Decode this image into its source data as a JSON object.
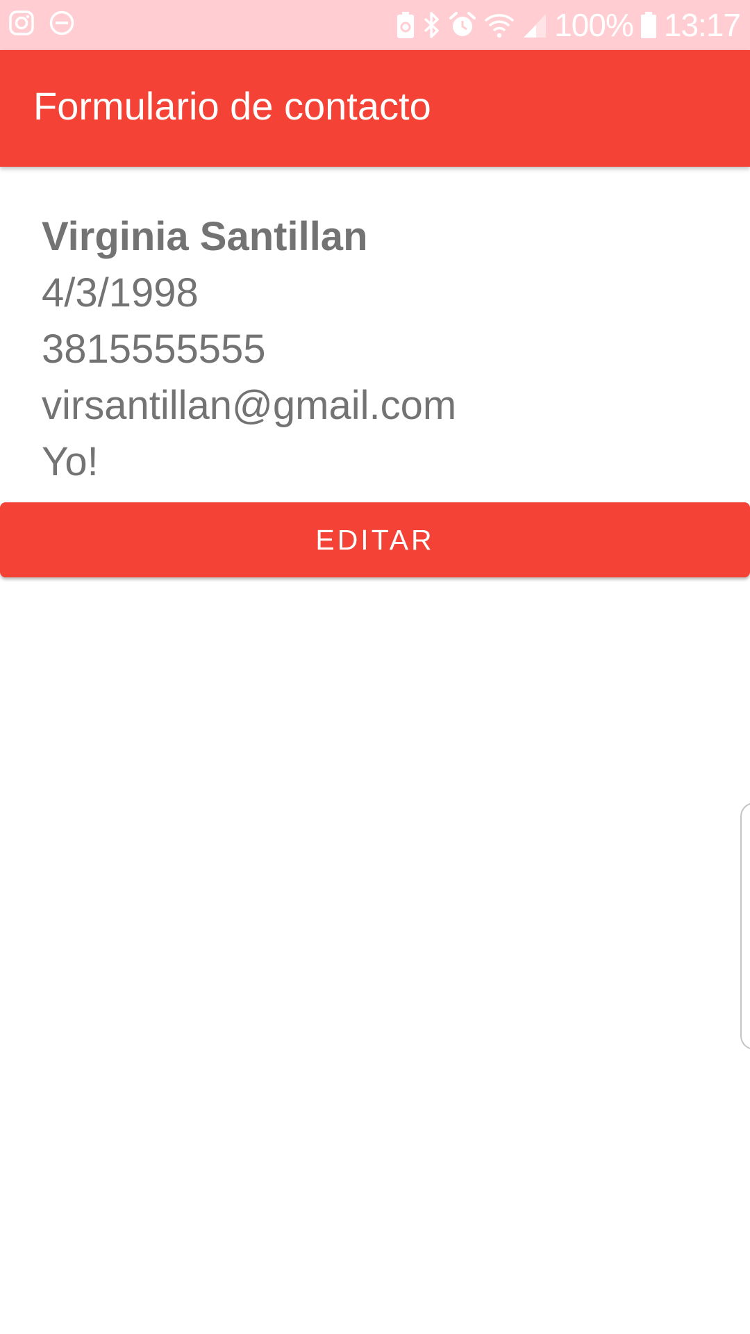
{
  "status_bar": {
    "left_icons": [
      "instagram-icon",
      "do-not-disturb-icon"
    ],
    "right_icons": [
      "battery-saver-icon",
      "bluetooth-icon",
      "alarm-icon",
      "wifi-icon",
      "signal-icon",
      "battery-icon"
    ],
    "battery_text": "100%",
    "time": "13:17"
  },
  "app_bar": {
    "title": "Formulario de contacto",
    "color": "#F44336"
  },
  "contact": {
    "name": "Virginia Santillan",
    "birthdate": "4/3/1998",
    "phone": "3815555555",
    "email": "virsantillan@gmail.com",
    "description": "Yo!"
  },
  "actions": {
    "edit_label": "EDITAR"
  },
  "colors": {
    "primary": "#F44336",
    "status_bar": "#FFCDD2",
    "text": "#737373"
  }
}
